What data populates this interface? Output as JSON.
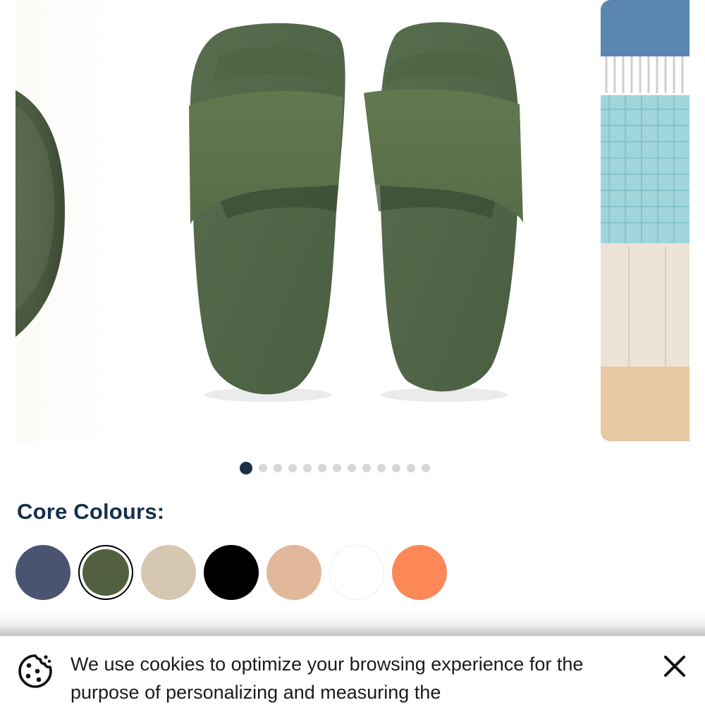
{
  "carousel": {
    "slide_count": 13,
    "active_index": 0
  },
  "colours": {
    "title": "Core Colours:",
    "swatches": [
      {
        "name": "navy",
        "hex": "#4a5370"
      },
      {
        "name": "khaki",
        "hex": "#536040",
        "selected": true
      },
      {
        "name": "sand",
        "hex": "#d6c7b2"
      },
      {
        "name": "black",
        "hex": "#000000"
      },
      {
        "name": "peach",
        "hex": "#e1b89b"
      },
      {
        "name": "white",
        "hex": "#ffffff"
      },
      {
        "name": "orange",
        "hex": "#fd8857"
      }
    ]
  },
  "cookie_banner": {
    "text": "We use cookies to optimize your browsing experience for the purpose of personalizing and measuring the",
    "icon": "cookie-icon",
    "close_icon": "close-icon"
  },
  "colors": {
    "heading": "#14304d",
    "dot_active": "#1c2f45",
    "dot_inactive": "#d7d7d7",
    "slide_green": "#4f6446"
  }
}
